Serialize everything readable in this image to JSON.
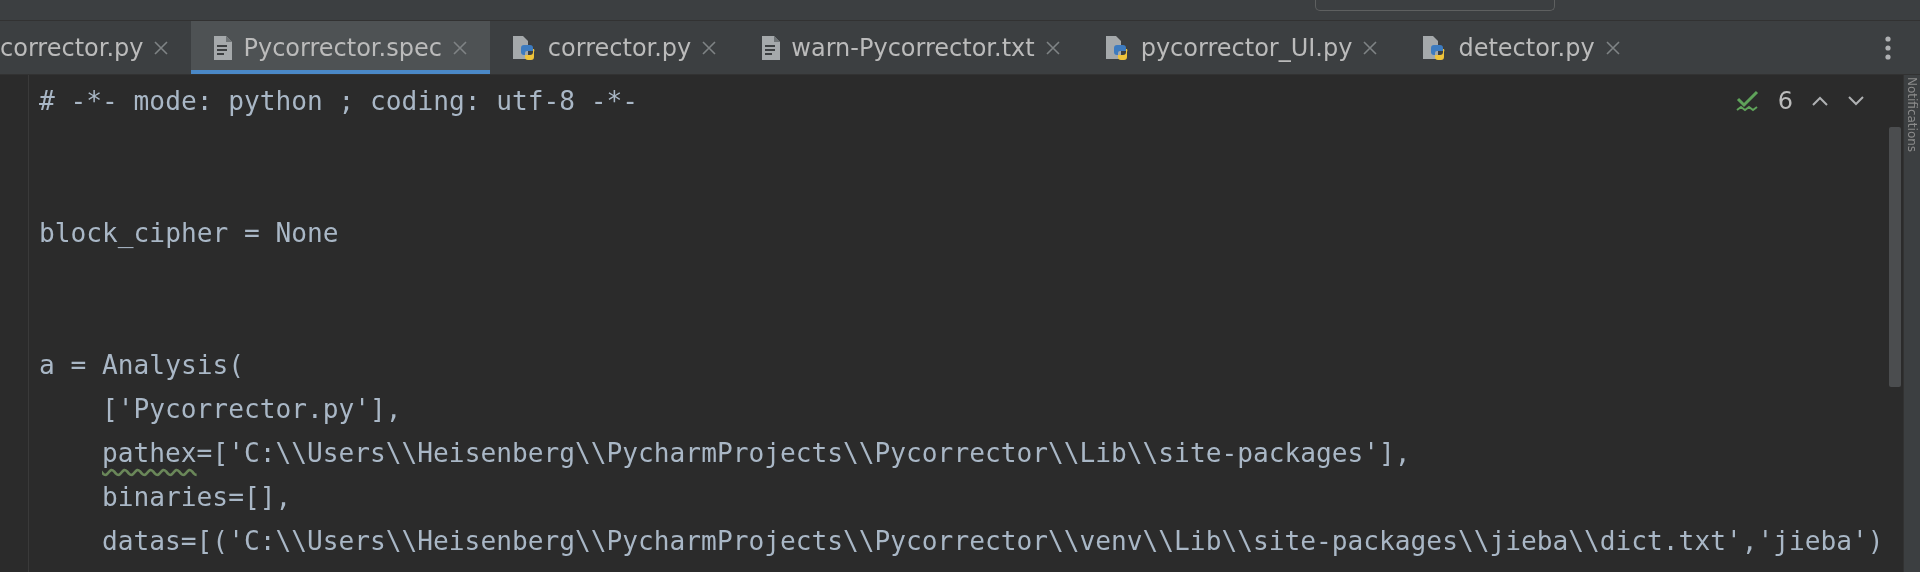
{
  "tabs": [
    {
      "label": "corrector.py",
      "kind": "cut",
      "selected": false
    },
    {
      "label": "Pycorrector.spec",
      "kind": "text",
      "selected": true
    },
    {
      "label": "corrector.py",
      "kind": "python",
      "selected": false
    },
    {
      "label": "warn-Pycorrector.txt",
      "kind": "text",
      "selected": false
    },
    {
      "label": "pycorrector_UI.py",
      "kind": "python",
      "selected": false
    },
    {
      "label": "detector.py",
      "kind": "python",
      "selected": false
    }
  ],
  "inspection": {
    "count": "6"
  },
  "side_stripe": {
    "label": "Notifications"
  },
  "code_lines": [
    {
      "kind": "code",
      "segments": [
        {
          "text": "# -*- mode: python ; coding: utf-8 -*-",
          "warning": false
        }
      ]
    },
    {
      "kind": "blank"
    },
    {
      "kind": "blank"
    },
    {
      "kind": "code",
      "segments": [
        {
          "text": "block_cipher = None",
          "warning": false
        }
      ]
    },
    {
      "kind": "blank"
    },
    {
      "kind": "blank"
    },
    {
      "kind": "code",
      "segments": [
        {
          "text": "a = Analysis(",
          "warning": false
        }
      ],
      "children": [
        {
          "kind": "code",
          "segments": [
            {
              "text": "['Pycorrector.py'],",
              "warning": false
            }
          ]
        },
        {
          "kind": "code",
          "segments": [
            {
              "text": "pathex",
              "warning": true
            },
            {
              "text": "=['C:\\\\Users\\\\Heisenberg\\\\PycharmProjects\\\\Pycorrector\\\\Lib\\\\site-packages'],",
              "warning": false
            }
          ]
        },
        {
          "kind": "code",
          "segments": [
            {
              "text": "binaries=[],",
              "warning": false
            }
          ]
        },
        {
          "kind": "code",
          "segments": [
            {
              "text": "datas=[('C:\\\\Users\\\\Heisenberg\\\\PycharmProjects\\\\Pycorrector\\\\venv\\\\Lib\\\\site-packages\\\\jieba\\\\dict.txt','jieba')",
              "warning": false
            }
          ]
        }
      ]
    }
  ]
}
